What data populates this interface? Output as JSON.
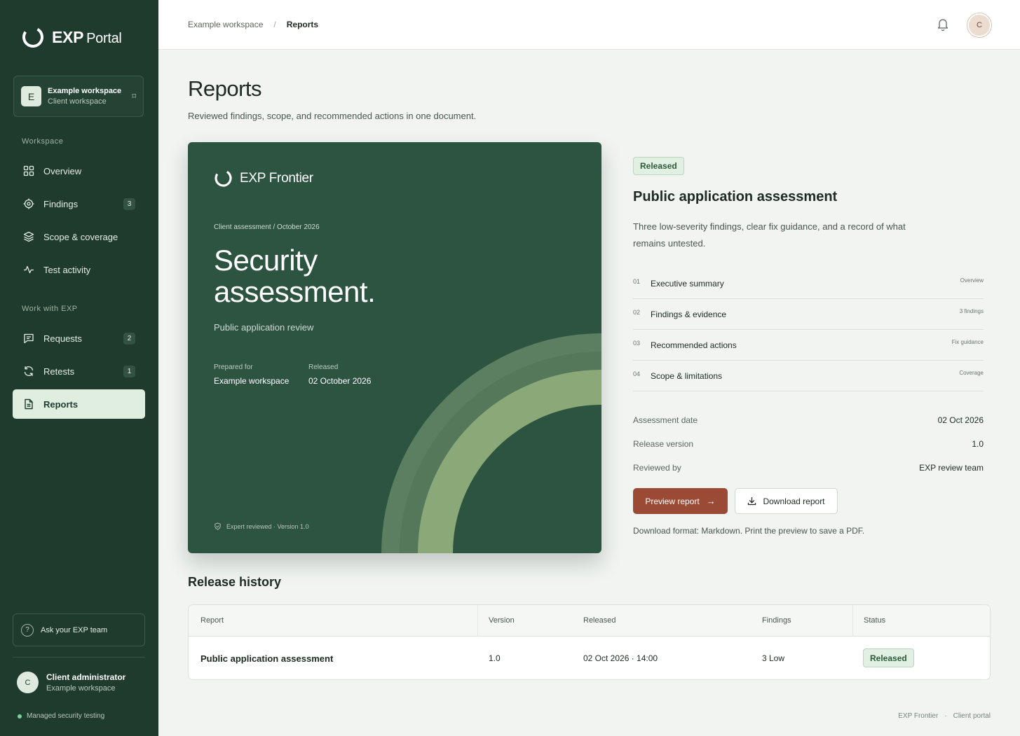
{
  "brand": {
    "bold": "EXP",
    "rest": "Portal"
  },
  "workspace_card": {
    "initial": "E",
    "name": "Example workspace",
    "sub": "Client workspace",
    "switch_icon": "switch-icon"
  },
  "sidebar": {
    "section_workspace": "Workspace",
    "section_work": "Work with EXP",
    "items": [
      {
        "label": "Overview",
        "icon": "grid-icon",
        "badge": ""
      },
      {
        "label": "Findings",
        "icon": "target-icon",
        "badge": "3"
      },
      {
        "label": "Scope & coverage",
        "icon": "layers-icon",
        "badge": ""
      },
      {
        "label": "Test activity",
        "icon": "activity-icon",
        "badge": ""
      },
      {
        "label": "Requests",
        "icon": "message-icon",
        "badge": "2"
      },
      {
        "label": "Retests",
        "icon": "refresh-icon",
        "badge": "1"
      },
      {
        "label": "Reports",
        "icon": "document-icon",
        "badge": ""
      }
    ],
    "ask": "Ask your EXP team",
    "user": {
      "initial": "C",
      "name": "Client administrator",
      "org": "Example workspace"
    },
    "managed": "Managed security testing"
  },
  "topbar": {
    "breadcrumbs": [
      "Example workspace",
      "Reports"
    ],
    "separator": "/",
    "avatar_initial": "C"
  },
  "page": {
    "title": "Reports",
    "subtitle": "Reviewed findings, scope, and recommended actions in one document."
  },
  "cover": {
    "brand": "EXP Frontier",
    "kicker": "Client assessment / October 2026",
    "title_line1": "Security",
    "title_line2": "assessment.",
    "desc": "Public application review",
    "prepared_label": "Prepared for",
    "prepared_value": "Example workspace",
    "released_label": "Released",
    "released_value": "02 October 2026",
    "footer": "Expert reviewed · Version 1.0"
  },
  "report": {
    "status": "Released",
    "title": "Public application assessment",
    "description": "Three low-severity findings, clear fix guidance, and a record of what remains untested.",
    "toc": [
      {
        "num": "01",
        "name": "Executive summary",
        "tag": "Overview"
      },
      {
        "num": "02",
        "name": "Findings & evidence",
        "tag": "3 findings"
      },
      {
        "num": "03",
        "name": "Recommended actions",
        "tag": "Fix guidance"
      },
      {
        "num": "04",
        "name": "Scope & limitations",
        "tag": "Coverage"
      }
    ],
    "facts": [
      {
        "label": "Assessment date",
        "value": "02 Oct 2026"
      },
      {
        "label": "Release version",
        "value": "1.0"
      },
      {
        "label": "Reviewed by",
        "value": "EXP review team"
      }
    ],
    "preview_label": "Preview report",
    "download_label": "Download report",
    "download_note": "Download format: Markdown. Print the preview to save a PDF."
  },
  "history": {
    "title": "Release history",
    "columns": [
      "Report",
      "Version",
      "Released",
      "Findings",
      "Status"
    ],
    "rows": [
      {
        "report": "Public application assessment",
        "version": "1.0",
        "released": "02 Oct 2026 · 14:00",
        "findings": "3 Low",
        "status": "Released"
      }
    ]
  },
  "footer": {
    "left": "EXP Frontier",
    "sep": "·",
    "right": "Client portal"
  },
  "colors": {
    "sidebar": "#1f3b2d",
    "cover": "#2d5440",
    "accent": "#9a4a35",
    "success_bg": "#e2f0e3"
  }
}
